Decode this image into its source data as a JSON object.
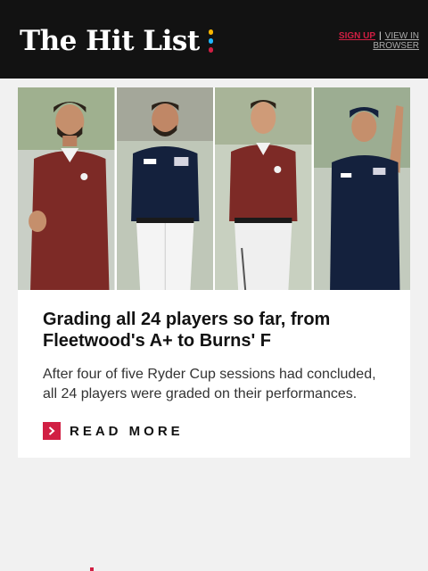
{
  "header": {
    "logo_text": "The Hit List",
    "logo_dot_colors": [
      "#f7b500",
      "#1fb6ff",
      "#d11f43"
    ],
    "signup_label": "SIGN UP",
    "separator": "|",
    "view_in_browser_label": "VIEW IN BROWSER"
  },
  "article": {
    "headline": "Grading all 24 players so far, from Fleetwood's A+ to Burns' F",
    "dek": "After four of five Ryder Cup sessions had concluded, all 24 players were graded on their performances.",
    "read_more_label": "READ MORE",
    "photo_panels": [
      "player-1",
      "player-2",
      "player-3",
      "player-4"
    ]
  },
  "colors": {
    "header_bg": "#121212",
    "accent": "#d11f43",
    "page_bg": "#f1f1f1",
    "europe_shirt": "#7d2a26",
    "usa_shirt": "#14213d"
  }
}
